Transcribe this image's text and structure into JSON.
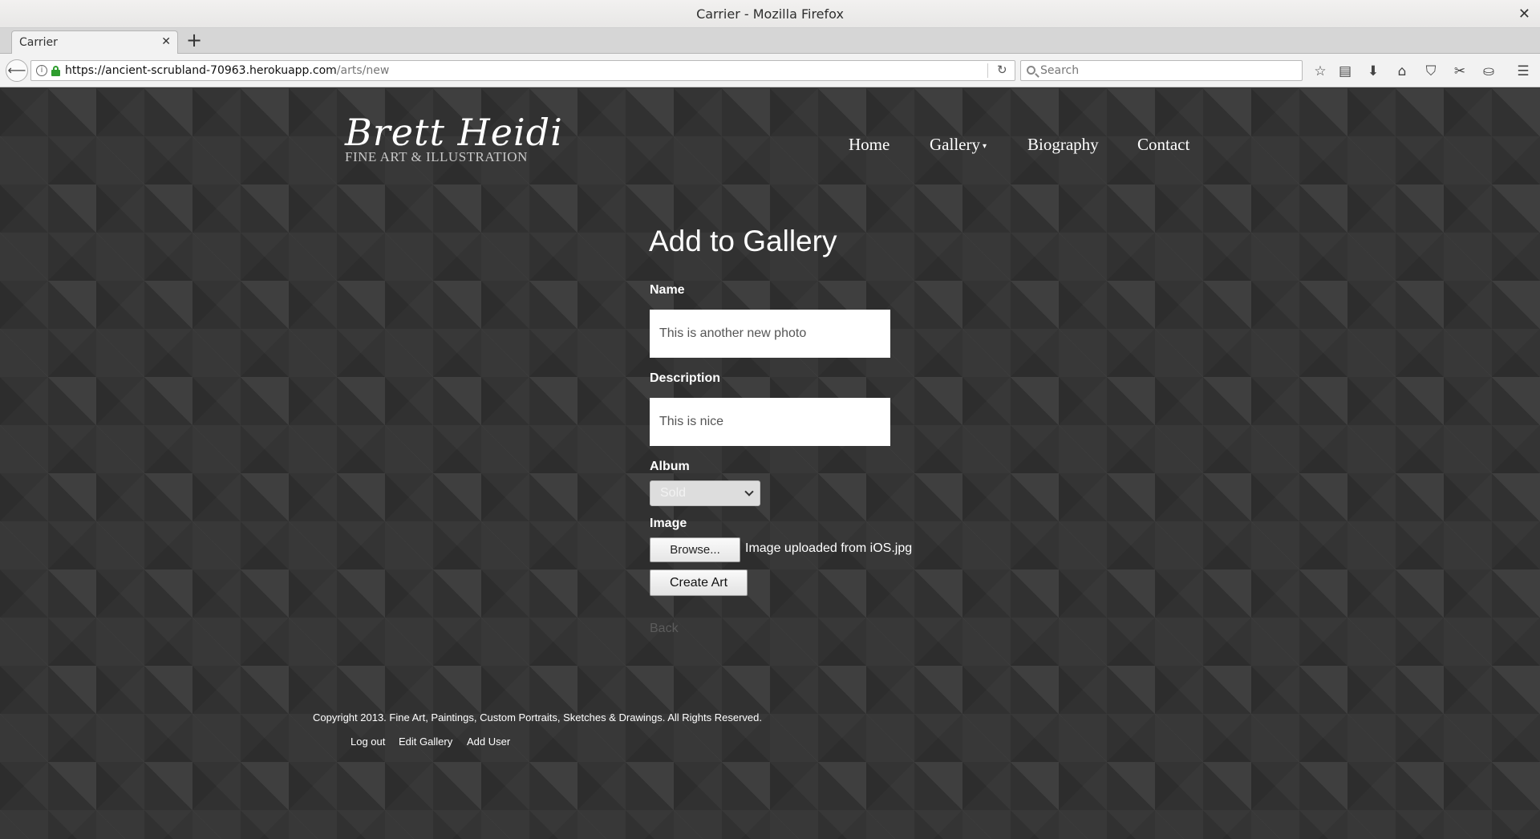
{
  "window": {
    "title": "Carrier - Mozilla Firefox",
    "close_glyph": "✕"
  },
  "tab": {
    "title": "Carrier",
    "close_glyph": "✕"
  },
  "newtab_glyph": "+",
  "navbar": {
    "back_glyph": "⟵",
    "url_host": "https://ancient-scrubland-70963.herokuapp.com",
    "url_path": "/arts/new",
    "reload_glyph": "↻",
    "search_placeholder": "Search",
    "icons": {
      "bookmark": "☆",
      "library": "▤",
      "download": "⬇",
      "home": "⌂",
      "pocket": "⛉",
      "screenshot": "✂",
      "sync": "⛀",
      "menu": "☰"
    }
  },
  "site": {
    "logo_script": "Brett Heidi",
    "logo_tagline": "FINE ART & ILLUSTRATION",
    "nav": {
      "home": "Home",
      "gallery": "Gallery",
      "gallery_caret": "▾",
      "biography": "Biography",
      "contact": "Contact"
    }
  },
  "form": {
    "heading": "Add to Gallery",
    "name_label": "Name",
    "name_value": "This is another new photo",
    "description_label": "Description",
    "description_value": "This is nice",
    "album_label": "Album",
    "album_value": "Sold",
    "image_label": "Image",
    "browse_label": "Browse...",
    "file_name": "Image uploaded from iOS.jpg",
    "submit_label": "Create Art",
    "back_label": "Back"
  },
  "footer": {
    "copyright": "Copyright 2013. Fine Art, Paintings, Custom Portraits, Sketches & Drawings. All Rights Reserved.",
    "links": {
      "logout": "Log out",
      "edit_gallery": "Edit Gallery",
      "add_user": "Add User"
    }
  }
}
